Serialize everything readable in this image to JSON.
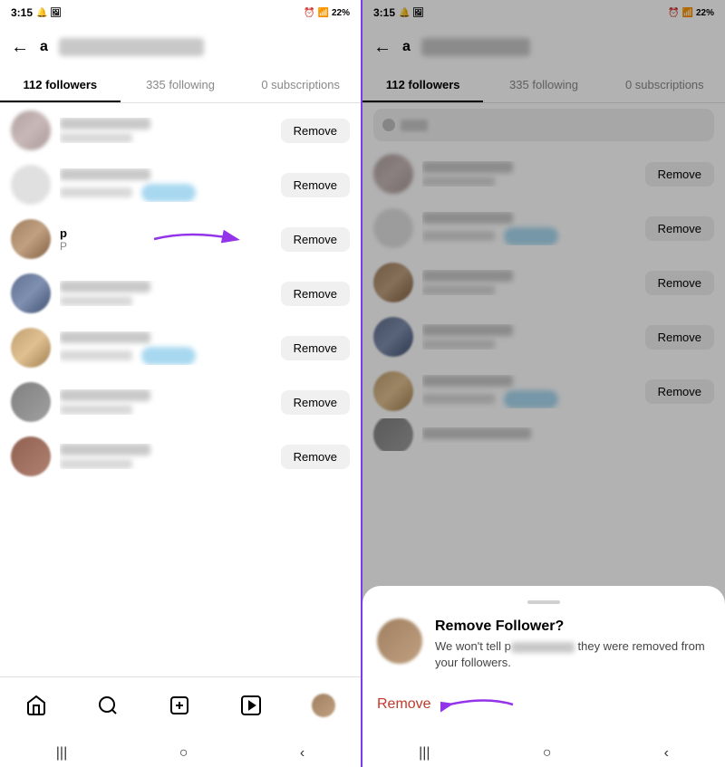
{
  "left_panel": {
    "status": {
      "time": "3:15",
      "battery": "22%"
    },
    "header": {
      "back": "←",
      "username_prefix": "a"
    },
    "tabs": [
      {
        "label": "112 followers",
        "active": true
      },
      {
        "label": "335 following",
        "active": false
      },
      {
        "label": "0 subscriptions",
        "active": false
      }
    ],
    "followers": [
      {
        "id": 1,
        "name_visible": false,
        "has_follow_badge": false
      },
      {
        "id": 2,
        "name_visible": false,
        "has_follow_badge": true
      },
      {
        "id": 3,
        "name_visible": true,
        "name": "p",
        "handle": "P",
        "has_follow_badge": false,
        "arrow": true
      },
      {
        "id": 4,
        "name_visible": false,
        "has_follow_badge": false
      },
      {
        "id": 5,
        "name_visible": false,
        "has_follow_badge": true
      },
      {
        "id": 6,
        "name_visible": false,
        "has_follow_badge": false
      },
      {
        "id": 7,
        "name_visible": false,
        "has_follow_badge": false
      }
    ],
    "remove_label": "Remove",
    "nav": {
      "home": "⌂",
      "search": "🔍",
      "add": "⊕",
      "reels": "▶",
      "profile": "avatar"
    }
  },
  "right_panel": {
    "status": {
      "time": "3:15",
      "battery": "22%"
    },
    "header": {
      "back": "←",
      "username_prefix": "a"
    },
    "tabs": [
      {
        "label": "112 followers",
        "active": true
      },
      {
        "label": "335 following",
        "active": false
      },
      {
        "label": "0 subscriptions",
        "active": false
      }
    ],
    "followers": [
      {
        "id": 1,
        "has_follow_badge": false
      },
      {
        "id": 2,
        "has_follow_badge": true
      },
      {
        "id": 3,
        "has_follow_badge": false
      },
      {
        "id": 4,
        "has_follow_badge": false
      },
      {
        "id": 5,
        "has_follow_badge": true
      },
      {
        "id": 6,
        "partial": true
      }
    ],
    "remove_label": "Remove",
    "sheet": {
      "title": "Remove Follower?",
      "desc_prefix": "We won't tell p",
      "desc_suffix": " they were removed from your followers.",
      "remove_label": "Remove"
    }
  }
}
